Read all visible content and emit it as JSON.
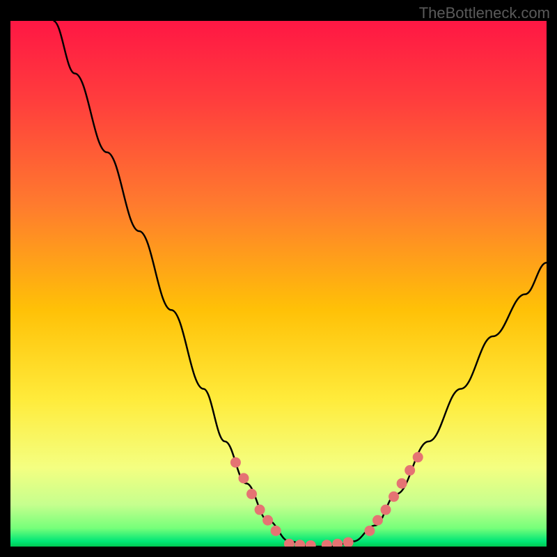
{
  "watermark": "TheBottleneck.com",
  "chart_data": {
    "type": "line",
    "title": "",
    "xlabel": "",
    "ylabel": "",
    "xlim": [
      0,
      100
    ],
    "ylim": [
      0,
      100
    ],
    "curve": [
      {
        "x": 8,
        "y": 100
      },
      {
        "x": 12,
        "y": 90
      },
      {
        "x": 18,
        "y": 75
      },
      {
        "x": 24,
        "y": 60
      },
      {
        "x": 30,
        "y": 45
      },
      {
        "x": 36,
        "y": 30
      },
      {
        "x": 40,
        "y": 20
      },
      {
        "x": 44,
        "y": 12
      },
      {
        "x": 48,
        "y": 5
      },
      {
        "x": 52,
        "y": 1
      },
      {
        "x": 56,
        "y": 0
      },
      {
        "x": 60,
        "y": 0
      },
      {
        "x": 64,
        "y": 1
      },
      {
        "x": 68,
        "y": 4
      },
      {
        "x": 72,
        "y": 10
      },
      {
        "x": 78,
        "y": 20
      },
      {
        "x": 84,
        "y": 30
      },
      {
        "x": 90,
        "y": 40
      },
      {
        "x": 96,
        "y": 48
      },
      {
        "x": 100,
        "y": 54
      }
    ],
    "highlighted_points_left": [
      {
        "x": 42,
        "y": 16
      },
      {
        "x": 43.5,
        "y": 13
      },
      {
        "x": 45,
        "y": 10
      },
      {
        "x": 46.5,
        "y": 7
      },
      {
        "x": 48,
        "y": 5
      },
      {
        "x": 49.5,
        "y": 3
      }
    ],
    "highlighted_points_bottom": [
      {
        "x": 52,
        "y": 0.5
      },
      {
        "x": 54,
        "y": 0.3
      },
      {
        "x": 56,
        "y": 0.2
      },
      {
        "x": 59,
        "y": 0.3
      },
      {
        "x": 61,
        "y": 0.5
      },
      {
        "x": 63,
        "y": 0.8
      }
    ],
    "highlighted_points_right": [
      {
        "x": 67,
        "y": 3
      },
      {
        "x": 68.5,
        "y": 5
      },
      {
        "x": 70,
        "y": 7
      },
      {
        "x": 71.5,
        "y": 9.5
      },
      {
        "x": 73,
        "y": 12
      },
      {
        "x": 74.5,
        "y": 14.5
      },
      {
        "x": 76,
        "y": 17
      }
    ],
    "gradient_stops": [
      {
        "offset": 0,
        "color": "#ff1744"
      },
      {
        "offset": 0.15,
        "color": "#ff3d3d"
      },
      {
        "offset": 0.35,
        "color": "#ff7b2e"
      },
      {
        "offset": 0.55,
        "color": "#ffc107"
      },
      {
        "offset": 0.72,
        "color": "#ffeb3b"
      },
      {
        "offset": 0.85,
        "color": "#f4ff81"
      },
      {
        "offset": 0.92,
        "color": "#c6ff8e"
      },
      {
        "offset": 0.965,
        "color": "#76ff7a"
      },
      {
        "offset": 0.99,
        "color": "#00e676"
      },
      {
        "offset": 1.0,
        "color": "#00c853"
      }
    ],
    "dot_color": "#e57373"
  }
}
